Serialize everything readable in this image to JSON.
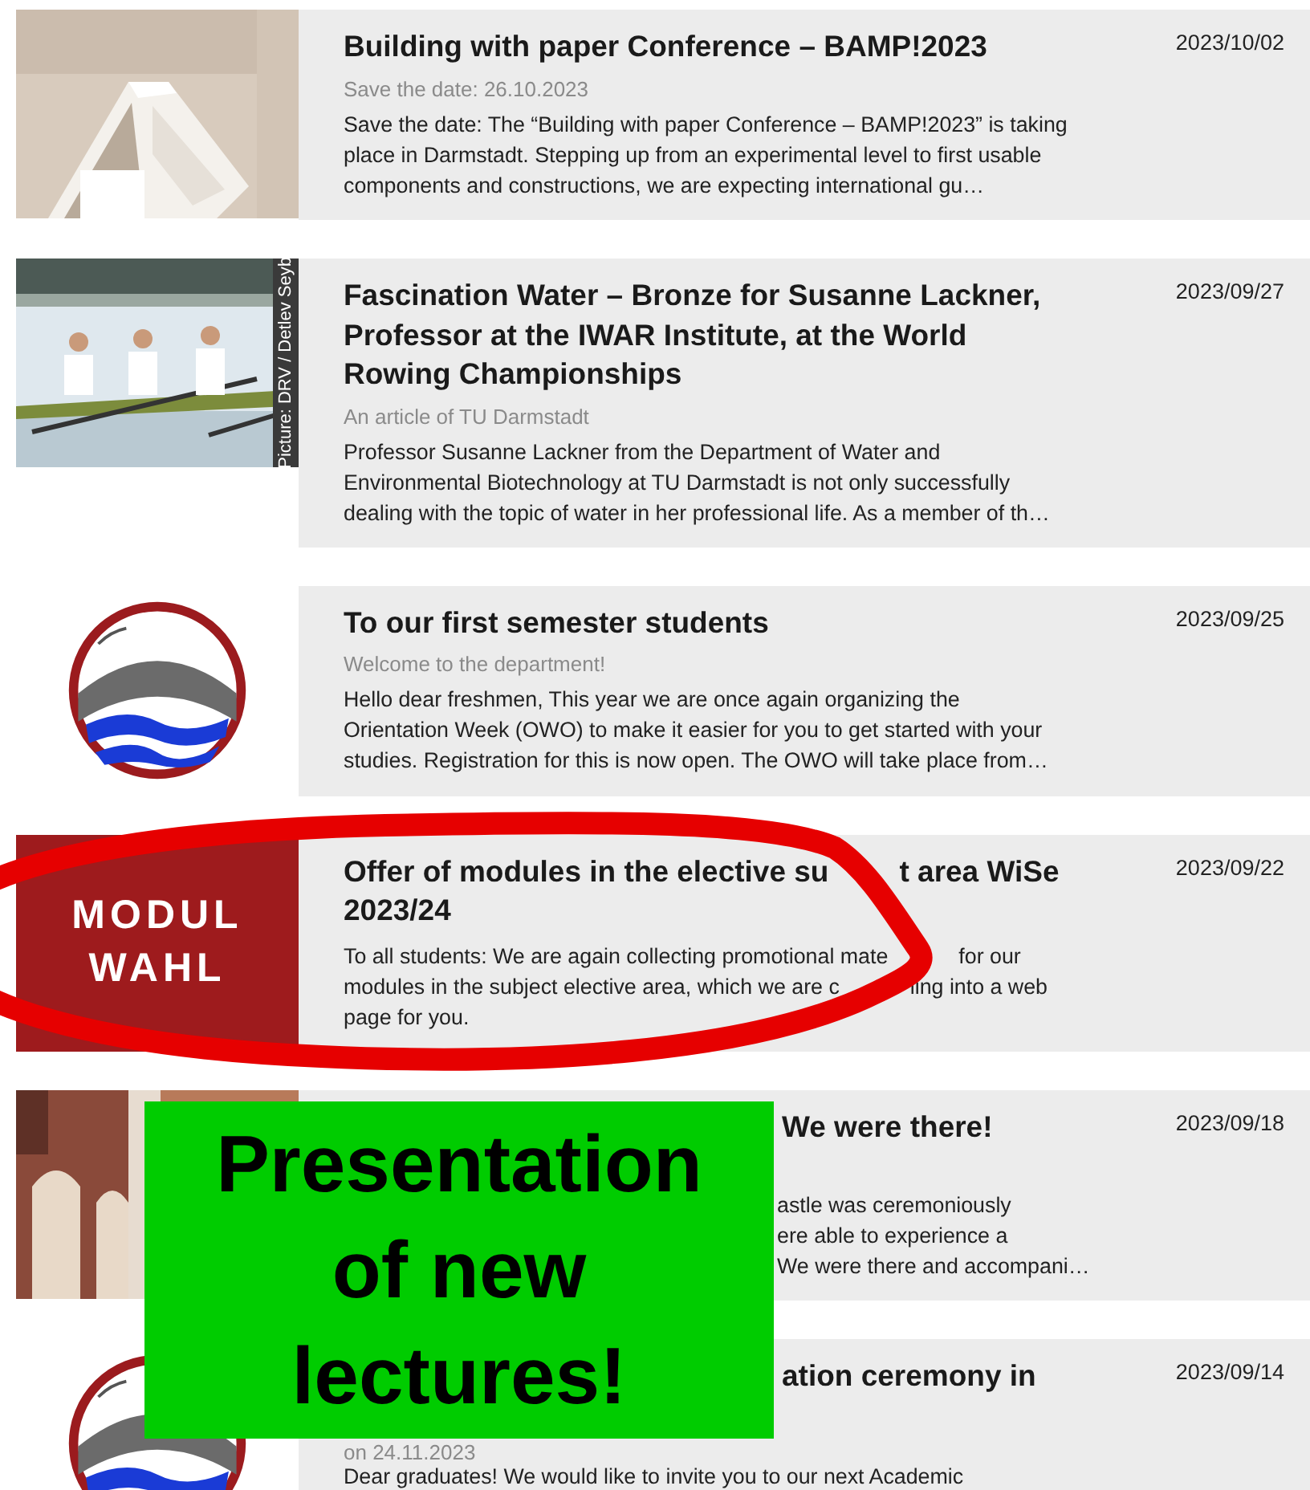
{
  "news": [
    {
      "kind": "full",
      "image": {
        "kind": "paper_house"
      },
      "title": "Building with paper Conference – BAMP!2023",
      "subtitle": "Save the date: 26.10.2023",
      "body": "Save the date: The “Building with paper Conference – BAMP!2023” is taking place in Darmstadt. Stepping up from an experimental level to first usable components and constructions, we are expecting international gu…",
      "date": "2023/10/02"
    },
    {
      "kind": "full",
      "image": {
        "kind": "rowing",
        "credit": "Picture: DRV / Detlev Seyb"
      },
      "title": "Fascination Water – Bronze for Susanne Lackner, Professor at the IWAR Institute, at the World Rowing Championships",
      "subtitle": "An article of TU Darmstadt",
      "body": "Professor Susanne Lackner from the Department of Water and Environmental Biotechnology at TU Darmstadt is not only successfully dealing with the topic of water in her professional life. As a member of th…",
      "date": "2023/09/27"
    },
    {
      "kind": "full",
      "image": {
        "kind": "logo"
      },
      "title": "To our first semester students",
      "subtitle": "Welcome to the department!",
      "body": "Hello dear freshmen, This year we are once again organizing the Orientation Week (OWO) to make it easier for you to get started with your studies. Registration for this is now open. The OWO will take place from…",
      "date": "2023/09/25"
    },
    {
      "kind": "crossed",
      "image": {
        "kind": "tile",
        "lines": [
          "MODUL",
          "WAHL"
        ]
      },
      "title_lines": [
        [
          "Offer of modules in the elective su",
          "t area WiSe"
        ],
        [
          "2023/24"
        ]
      ],
      "body_lines": [
        [
          "To all students: We are again collecting promotional mate",
          "for our"
        ],
        [
          "modules in the subject elective area, which we are c",
          "ling into a web"
        ],
        [
          "page for you."
        ]
      ],
      "date": "2023/09/22"
    },
    {
      "kind": "covered",
      "image": {
        "kind": "building"
      },
      "title": "We were there!",
      "lines": [
        "astle was ceremoniously",
        "ere able to experience a",
        "We were there and accompani…"
      ],
      "date": "2023/09/18"
    },
    {
      "kind": "covered",
      "image": {
        "kind": "logo"
      },
      "title": "ation ceremony in",
      "subtitle": "on 24.11.2023",
      "lines": [
        "Dear graduates! We would like to invite you to our next Academic"
      ],
      "date": "2023/09/14"
    }
  ],
  "annotations": [
    {
      "kind": "ellipse"
    },
    {
      "kind": "label",
      "text": "Presentation of new lectures!"
    }
  ]
}
